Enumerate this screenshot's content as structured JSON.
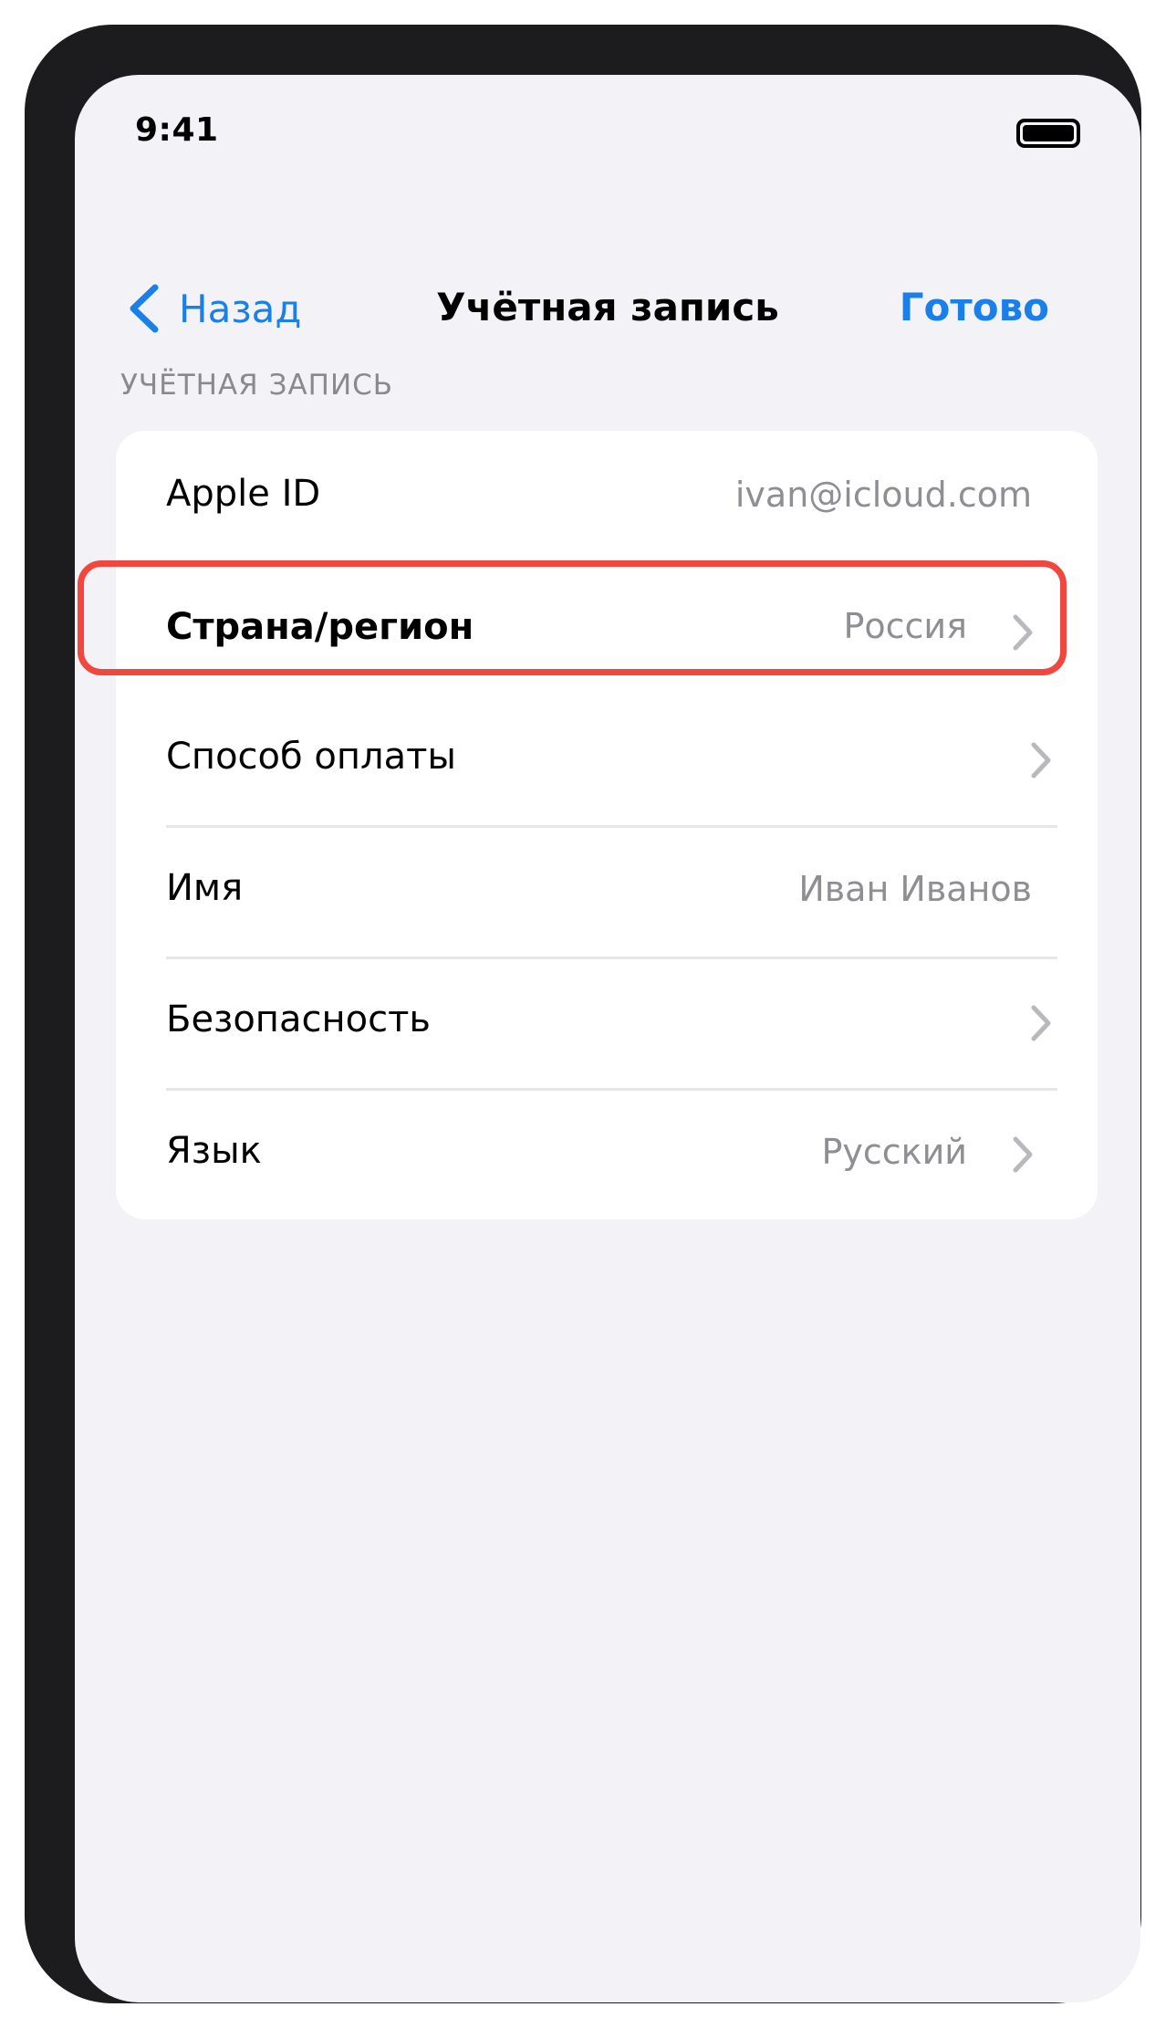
{
  "status_bar": {
    "time": "9:41",
    "battery_icon": "battery-full-icon"
  },
  "nav": {
    "back_label": "Назад",
    "back_icon": "chevron-left-icon",
    "title": "Учётная запись",
    "done_label": "Готово"
  },
  "section": {
    "header": "УЧЁТНАЯ ЗАПИСЬ"
  },
  "rows": [
    {
      "label": "Apple ID",
      "value": "ivan@icloud.com",
      "chevron": false
    },
    {
      "label": "Страна/регион",
      "value": "Россия",
      "chevron": true,
      "highlighted": true
    },
    {
      "label": "Способ оплаты",
      "value": "",
      "chevron": true
    },
    {
      "label": "Имя",
      "value": "Иван Иванов",
      "chevron": false
    },
    {
      "label": "Безопасность",
      "value": "",
      "chevron": true
    },
    {
      "label": "Язык",
      "value": "Русский",
      "chevron": true
    }
  ],
  "colors": {
    "accent": "#1a7fe8",
    "highlight_border": "#f0483e",
    "background": "#f2f2f7",
    "secondary_text": "#8e8e93"
  }
}
